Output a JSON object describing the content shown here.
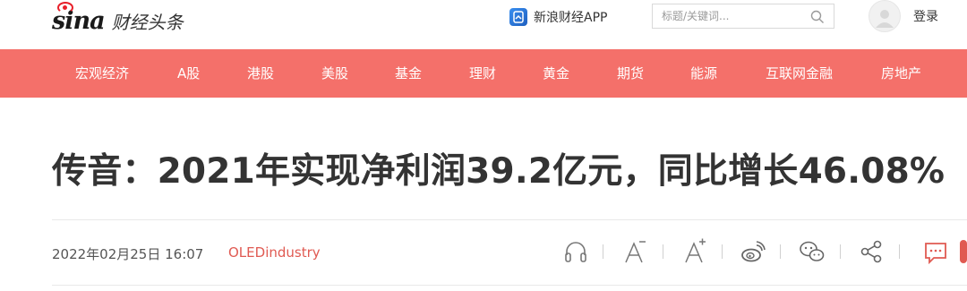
{
  "header": {
    "logo_text": "sina",
    "logo_subtitle": "财经头条",
    "app_link_label": "新浪财经APP",
    "search_placeholder": "标题/关键词...",
    "login_label": "登录",
    "accent_color": "#e8202a"
  },
  "nav": {
    "background": "#f4706a",
    "items": [
      {
        "label": "宏观经济"
      },
      {
        "label": "A股"
      },
      {
        "label": "港股"
      },
      {
        "label": "美股"
      },
      {
        "label": "基金"
      },
      {
        "label": "理财"
      },
      {
        "label": "黄金"
      },
      {
        "label": "期货"
      },
      {
        "label": "能源"
      },
      {
        "label": "互联网金融"
      },
      {
        "label": "房地产"
      }
    ]
  },
  "article": {
    "title": "传音：2021年实现净利润39.2亿元，同比增长46.08%",
    "date": "2022年02月25日 16:07",
    "source": "OLEDindustry",
    "source_color": "#e05a52"
  },
  "toolbar": {
    "icons": [
      "headphones-icon",
      "font-decrease-icon",
      "font-increase-icon",
      "weibo-icon",
      "wechat-icon",
      "share-icon",
      "comment-icon"
    ],
    "comment_color": "#e05a52"
  }
}
